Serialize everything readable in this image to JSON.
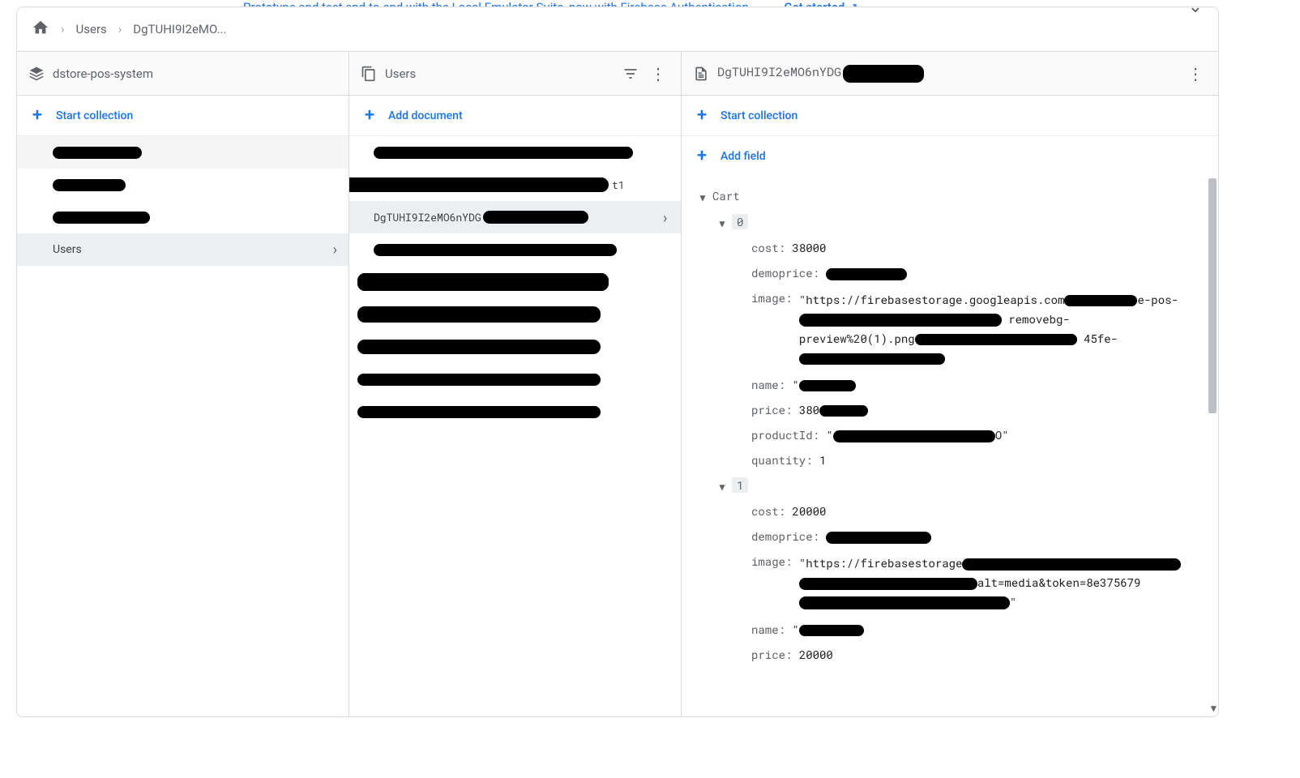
{
  "banner": {
    "text": "Prototype and test end-to-end with the Local Emulator Suite, now with Firebase Authentication",
    "cta": "Get started"
  },
  "breadcrumbs": {
    "item1": "Users",
    "item2": "DgTUHI9I2eMO..."
  },
  "panel1": {
    "title": "dstore-pos-system",
    "action": "Start collection",
    "users_label": "Users"
  },
  "panel2": {
    "title": "Users",
    "action": "Add document",
    "selected_doc": "DgTUHI9I2eMO6nYDG",
    "doc_prefix_t1": "t1"
  },
  "panel3": {
    "title": "DgTUHI9I2eMO6nYDG",
    "start_collection": "Start collection",
    "add_field": "Add field",
    "cart_label": "Cart",
    "idx0": "0",
    "idx1": "1",
    "item0": {
      "cost_k": "cost:",
      "cost_v": "38000",
      "demoprice_k": "demoprice:",
      "image_k": "image:",
      "image_v1": "\"https://firebasestorage.googleapis.com",
      "image_v1b": "e-pos-",
      "image_v2b": "removebg-",
      "image_v3a": "preview%20(1).png",
      "image_v3b": "45fe-",
      "name_k": "name:",
      "price_k": "price:",
      "price_v": "380",
      "productId_k": "productId:",
      "productId_suffix": "O\"",
      "quantity_k": "quantity:",
      "quantity_v": "1"
    },
    "item1": {
      "cost_k": "cost:",
      "cost_v": "20000",
      "demoprice_k": "demoprice:",
      "image_k": "image:",
      "image_v1": "\"https://firebasestorage",
      "image_v2b": "alt=media&token=8e375679",
      "name_k": "name:",
      "price_k": "price:",
      "price_v": "20000"
    }
  }
}
